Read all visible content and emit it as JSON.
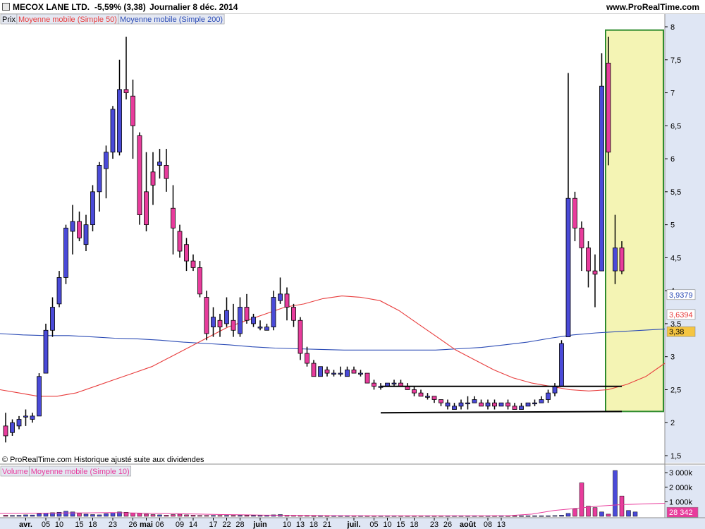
{
  "header": {
    "title": "MECOX LANE LTD.",
    "change": "-5,59% (3,38)",
    "period": "Journalier  8 déc. 2014",
    "site": "www.ProRealTime.com"
  },
  "legend": {
    "price": "Prix",
    "ma50": "Moyenne mobile (Simple 50)",
    "ma200": "Moyenne mobile (Simple 200)",
    "volume": "Volume",
    "vol_ma": "Moyenne mobile (Simple 10)"
  },
  "footer_note": "© ProRealTime.com  Historique ajusté suite aux dividendes",
  "colors": {
    "up": "#4a4ad8",
    "down": "#e83c9c",
    "ma50": "#e83c3c",
    "ma200": "#2b4bb5",
    "highlight_fill": "#f4f4b4",
    "highlight_border": "#2e8b2e"
  },
  "badges": {
    "ma200_value": "3,9379",
    "ma50_value": "3,6394",
    "last_value": "3,38"
  },
  "volume_badge": "28 342",
  "chart_data": [
    {
      "type": "candlestick",
      "price_axis": {
        "min": 1.5,
        "max": 8,
        "ticks": [
          1.5,
          2,
          2.5,
          3,
          3.5,
          4,
          4.5,
          5,
          5.5,
          6,
          6.5,
          7,
          7.5,
          8
        ],
        "tick_labels": [
          "1,5",
          "2",
          "2,5",
          "3",
          "3,5",
          "4",
          "4,5",
          "5",
          "5,5",
          "6",
          "6,5",
          "7",
          "7,5",
          "8"
        ]
      },
      "x_labels": [
        {
          "i": 3,
          "label": "avr.",
          "bold": true
        },
        {
          "i": 6,
          "label": "05"
        },
        {
          "i": 8,
          "label": "10"
        },
        {
          "i": 11,
          "label": "15"
        },
        {
          "i": 13,
          "label": "18"
        },
        {
          "i": 16,
          "label": "23"
        },
        {
          "i": 19,
          "label": "26"
        },
        {
          "i": 21,
          "label": "mai",
          "bold": true
        },
        {
          "i": 23,
          "label": "06"
        },
        {
          "i": 26,
          "label": "09"
        },
        {
          "i": 28,
          "label": "14"
        },
        {
          "i": 31,
          "label": "17"
        },
        {
          "i": 33,
          "label": "22"
        },
        {
          "i": 35,
          "label": "28"
        },
        {
          "i": 38,
          "label": "juin",
          "bold": true
        },
        {
          "i": 42,
          "label": "10"
        },
        {
          "i": 44,
          "label": "13"
        },
        {
          "i": 46,
          "label": "18"
        },
        {
          "i": 48,
          "label": "21"
        },
        {
          "i": 52,
          "label": "juil.",
          "bold": true
        },
        {
          "i": 55,
          "label": "05"
        },
        {
          "i": 57,
          "label": "10"
        },
        {
          "i": 59,
          "label": "15"
        },
        {
          "i": 61,
          "label": "18"
        },
        {
          "i": 64,
          "label": "23"
        },
        {
          "i": 66,
          "label": "26"
        },
        {
          "i": 69,
          "label": "août",
          "bold": true
        },
        {
          "i": 72,
          "label": "08"
        },
        {
          "i": 74,
          "label": "13"
        }
      ],
      "candles": [
        [
          1.95,
          2.15,
          1.7,
          1.8
        ],
        [
          1.85,
          2.05,
          1.8,
          2.0
        ],
        [
          1.95,
          2.1,
          1.9,
          2.05
        ],
        [
          2.1,
          2.2,
          1.95,
          2.1
        ],
        [
          2.05,
          2.15,
          2.0,
          2.1
        ],
        [
          2.1,
          2.75,
          2.1,
          2.7
        ],
        [
          2.75,
          3.5,
          2.75,
          3.4
        ],
        [
          3.4,
          3.9,
          3.3,
          3.75
        ],
        [
          3.8,
          4.3,
          3.75,
          4.2
        ],
        [
          4.2,
          5.0,
          4.1,
          4.95
        ],
        [
          4.9,
          5.3,
          4.55,
          5.05
        ],
        [
          5.05,
          5.2,
          4.75,
          4.8
        ],
        [
          4.7,
          5.15,
          4.6,
          5.0
        ],
        [
          5.0,
          5.6,
          4.9,
          5.5
        ],
        [
          5.5,
          5.95,
          5.2,
          5.9
        ],
        [
          5.85,
          6.2,
          5.4,
          6.1
        ],
        [
          6.1,
          6.8,
          6.0,
          6.75
        ],
        [
          6.1,
          7.5,
          6.05,
          7.05
        ],
        [
          7.05,
          7.85,
          6.9,
          7.0
        ],
        [
          6.95,
          7.2,
          6.0,
          6.5
        ],
        [
          6.35,
          6.4,
          5.0,
          5.15
        ],
        [
          5.5,
          6.1,
          4.9,
          5.0
        ],
        [
          5.8,
          6.1,
          5.3,
          5.6
        ],
        [
          5.9,
          6.15,
          5.7,
          5.95
        ],
        [
          5.9,
          6.15,
          5.5,
          5.7
        ],
        [
          5.25,
          5.6,
          4.55,
          4.95
        ],
        [
          4.9,
          5.0,
          4.5,
          4.6
        ],
        [
          4.7,
          4.8,
          4.3,
          4.45
        ],
        [
          4.45,
          4.55,
          4.3,
          4.35
        ],
        [
          4.35,
          4.45,
          3.9,
          3.95
        ],
        [
          3.9,
          4.0,
          3.25,
          3.35
        ],
        [
          3.45,
          3.75,
          3.3,
          3.6
        ],
        [
          3.55,
          3.65,
          3.3,
          3.45
        ],
        [
          3.5,
          3.9,
          3.45,
          3.7
        ],
        [
          3.55,
          3.8,
          3.3,
          3.4
        ],
        [
          3.35,
          3.9,
          3.3,
          3.75
        ],
        [
          3.75,
          3.95,
          3.5,
          3.55
        ],
        [
          3.5,
          3.65,
          3.45,
          3.6
        ],
        [
          3.45,
          3.55,
          3.4,
          3.45
        ],
        [
          3.4,
          3.5,
          3.4,
          3.45
        ],
        [
          3.45,
          4.0,
          3.4,
          3.9
        ],
        [
          3.85,
          4.2,
          3.8,
          3.95
        ],
        [
          3.95,
          4.05,
          3.55,
          3.75
        ],
        [
          3.75,
          3.8,
          3.45,
          3.55
        ],
        [
          3.55,
          3.6,
          2.95,
          3.05
        ],
        [
          3.05,
          3.15,
          2.85,
          2.9
        ],
        [
          2.9,
          2.95,
          2.7,
          2.7
        ],
        [
          2.7,
          2.85,
          2.7,
          2.85
        ],
        [
          2.8,
          2.85,
          2.7,
          2.75
        ],
        [
          2.75,
          2.8,
          2.7,
          2.75
        ],
        [
          2.75,
          2.85,
          2.7,
          2.75
        ],
        [
          2.7,
          2.85,
          2.7,
          2.8
        ],
        [
          2.8,
          2.85,
          2.75,
          2.75
        ],
        [
          2.75,
          2.8,
          2.7,
          2.75
        ],
        [
          2.75,
          2.75,
          2.6,
          2.6
        ],
        [
          2.6,
          2.65,
          2.5,
          2.55
        ],
        [
          2.55,
          2.6,
          2.5,
          2.55
        ],
        [
          2.55,
          2.6,
          2.55,
          2.6
        ],
        [
          2.6,
          2.65,
          2.55,
          2.6
        ],
        [
          2.6,
          2.65,
          2.55,
          2.55
        ],
        [
          2.55,
          2.6,
          2.5,
          2.5
        ],
        [
          2.5,
          2.55,
          2.4,
          2.45
        ],
        [
          2.45,
          2.5,
          2.4,
          2.4
        ],
        [
          2.4,
          2.45,
          2.35,
          2.4
        ],
        [
          2.4,
          2.4,
          2.3,
          2.35
        ],
        [
          2.35,
          2.35,
          2.25,
          2.3
        ],
        [
          2.25,
          2.35,
          2.2,
          2.3
        ],
        [
          2.2,
          2.3,
          2.2,
          2.25
        ],
        [
          2.25,
          2.35,
          2.2,
          2.3
        ],
        [
          2.3,
          2.4,
          2.2,
          2.3
        ],
        [
          2.3,
          2.4,
          2.3,
          2.35
        ],
        [
          2.3,
          2.35,
          2.25,
          2.25
        ],
        [
          2.25,
          2.35,
          2.2,
          2.3
        ],
        [
          2.3,
          2.35,
          2.2,
          2.25
        ],
        [
          2.25,
          2.3,
          2.25,
          2.3
        ],
        [
          2.3,
          2.35,
          2.2,
          2.25
        ],
        [
          2.25,
          2.3,
          2.2,
          2.2
        ],
        [
          2.2,
          2.3,
          2.2,
          2.25
        ],
        [
          2.25,
          2.3,
          2.25,
          2.3
        ],
        [
          2.3,
          2.35,
          2.25,
          2.3
        ],
        [
          2.3,
          2.4,
          2.3,
          2.35
        ],
        [
          2.35,
          2.5,
          2.3,
          2.45
        ],
        [
          2.45,
          2.6,
          2.4,
          2.55
        ],
        [
          2.55,
          3.25,
          2.55,
          3.2
        ],
        [
          3.3,
          7.3,
          3.3,
          5.4
        ],
        [
          5.4,
          5.5,
          4.75,
          4.95
        ],
        [
          4.95,
          5.05,
          4.3,
          4.65
        ],
        [
          4.65,
          4.75,
          4.05,
          4.3
        ],
        [
          4.3,
          4.55,
          3.75,
          4.25
        ],
        [
          4.3,
          7.6,
          4.3,
          7.1
        ],
        [
          7.45,
          7.85,
          5.9,
          6.1
        ],
        [
          4.3,
          5.15,
          4.1,
          4.65
        ],
        [
          4.65,
          4.75,
          4.25,
          4.3
        ]
      ],
      "ma50": [
        2.5,
        2.45,
        2.4,
        2.4,
        2.45,
        2.55,
        2.65,
        2.75,
        2.85,
        3.0,
        3.15,
        3.3,
        3.45,
        3.55,
        3.65,
        3.75,
        3.8,
        3.88,
        3.92,
        3.9,
        3.85,
        3.7,
        3.5,
        3.3,
        3.1,
        2.95,
        2.8,
        2.68,
        2.6,
        2.55,
        2.5,
        2.48,
        2.5,
        2.58,
        2.7,
        2.9
      ],
      "ma200": [
        3.35,
        3.33,
        3.32,
        3.32,
        3.3,
        3.28,
        3.27,
        3.25,
        3.22,
        3.2,
        3.18,
        3.15,
        3.13,
        3.12,
        3.11,
        3.1,
        3.1,
        3.1,
        3.1,
        3.1,
        3.12,
        3.14,
        3.18,
        3.22,
        3.28,
        3.33,
        3.36,
        3.38,
        3.4,
        3.42
      ],
      "support_line": {
        "from_i": 56,
        "to_i": 92,
        "y_from": 2.15,
        "y_to": 2.17
      },
      "resistance_line": {
        "from_i": 56,
        "to_i": 92,
        "y_from": 2.55,
        "y_to": 2.55
      },
      "highlight_zone": {
        "from_i": 90,
        "to_i": 102,
        "y_min": 2.17,
        "y_max": 7.95
      }
    },
    {
      "type": "bar",
      "name": "Volume",
      "y_ticks": [
        "1 000k",
        "2 000k",
        "3 000k"
      ],
      "y_tick_values": [
        1000,
        2000,
        3000
      ],
      "y_max": 3300,
      "values": [
        80,
        60,
        70,
        100,
        90,
        180,
        230,
        250,
        280,
        350,
        300,
        200,
        150,
        120,
        100,
        180,
        250,
        300,
        280,
        220,
        200,
        150,
        120,
        100,
        80,
        120,
        150,
        100,
        80,
        60,
        60,
        60,
        60,
        60,
        60,
        60,
        60,
        60,
        60,
        60,
        100,
        120,
        80,
        60,
        60,
        50,
        40,
        40,
        40,
        40,
        40,
        40,
        40,
        40,
        40,
        40,
        40,
        40,
        40,
        40,
        40,
        40,
        40,
        40,
        40,
        40,
        40,
        40,
        40,
        40,
        40,
        40,
        40,
        40,
        40,
        40,
        40,
        40,
        40,
        40,
        40,
        40,
        50,
        80,
        200,
        500,
        2300,
        700,
        600,
        300,
        150,
        3150,
        1400,
        400,
        300
      ],
      "ma10": [
        200,
        210,
        220,
        230,
        240,
        250,
        230,
        200,
        180,
        150,
        120,
        100,
        80,
        70,
        60,
        50,
        45,
        40,
        40,
        40,
        40,
        40,
        40,
        50,
        150,
        400,
        550,
        700,
        800,
        850,
        900
      ]
    }
  ]
}
